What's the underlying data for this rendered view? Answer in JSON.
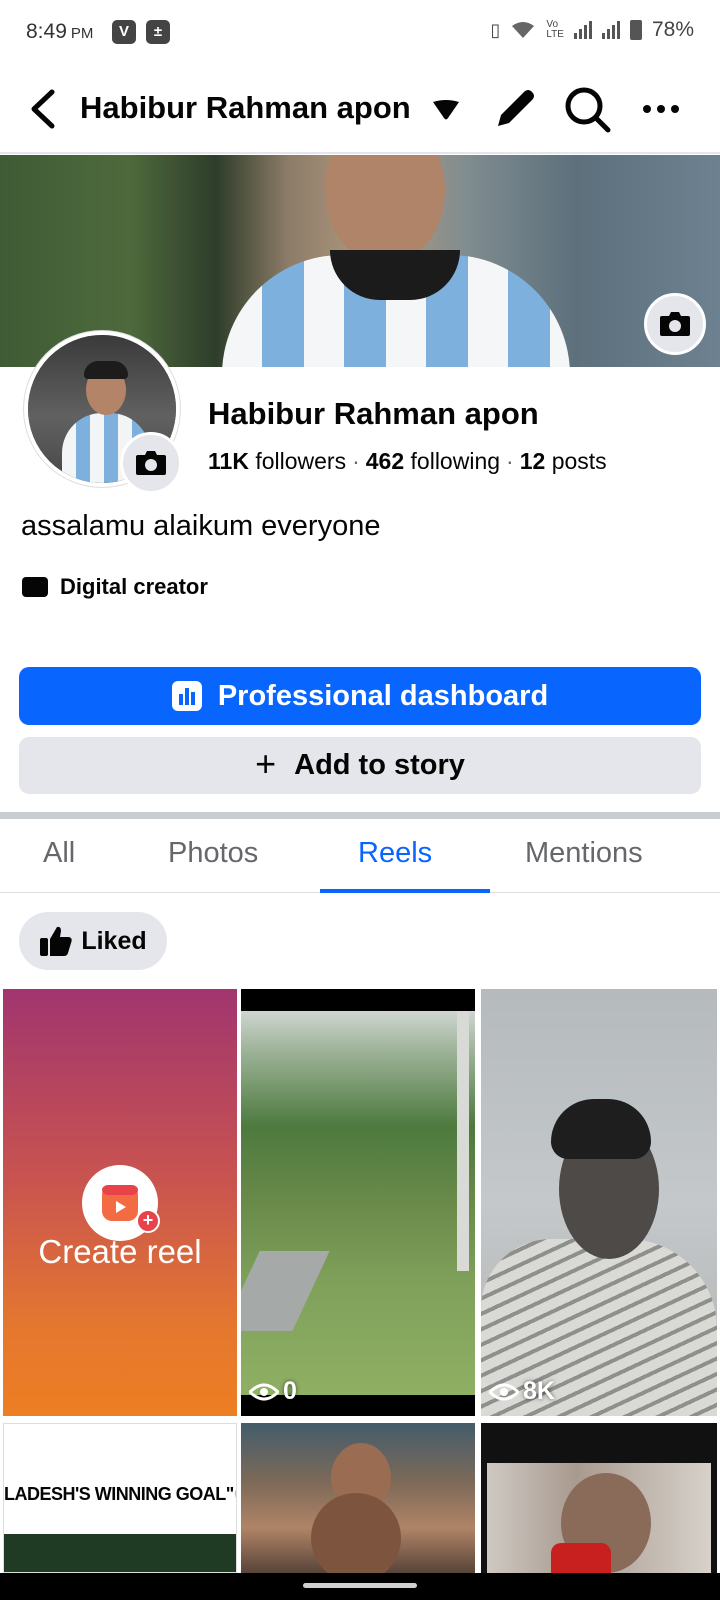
{
  "status_bar": {
    "time": "8:49",
    "ampm": "PM",
    "battery": "78%",
    "app_icons": [
      "V-icon",
      "calculator-icon"
    ]
  },
  "header": {
    "title": "Habibur Rahman apon"
  },
  "profile": {
    "name": "Habibur Rahman apon",
    "followers_count": "11K",
    "followers_label": "followers",
    "following_count": "462",
    "following_label": "following",
    "posts_count": "12",
    "posts_label": "posts",
    "bio": "assalamu alaikum everyone",
    "category": "Digital creator"
  },
  "actions": {
    "professional_dashboard": "Professional dashboard",
    "add_to_story": "Add to story"
  },
  "tabs": [
    {
      "label": "All"
    },
    {
      "label": "Photos"
    },
    {
      "label": "Reels",
      "active": true
    },
    {
      "label": "Mentions"
    }
  ],
  "filter_chip": "Liked",
  "reels": {
    "create_label": "Create reel",
    "items": [
      {
        "views": "0"
      },
      {
        "views": "8K"
      }
    ],
    "row2_caption": "LADESH'S WINNING GOAL\"🥹"
  },
  "colors": {
    "accent": "#0866ff",
    "chip_bg": "#e4e6eb"
  }
}
